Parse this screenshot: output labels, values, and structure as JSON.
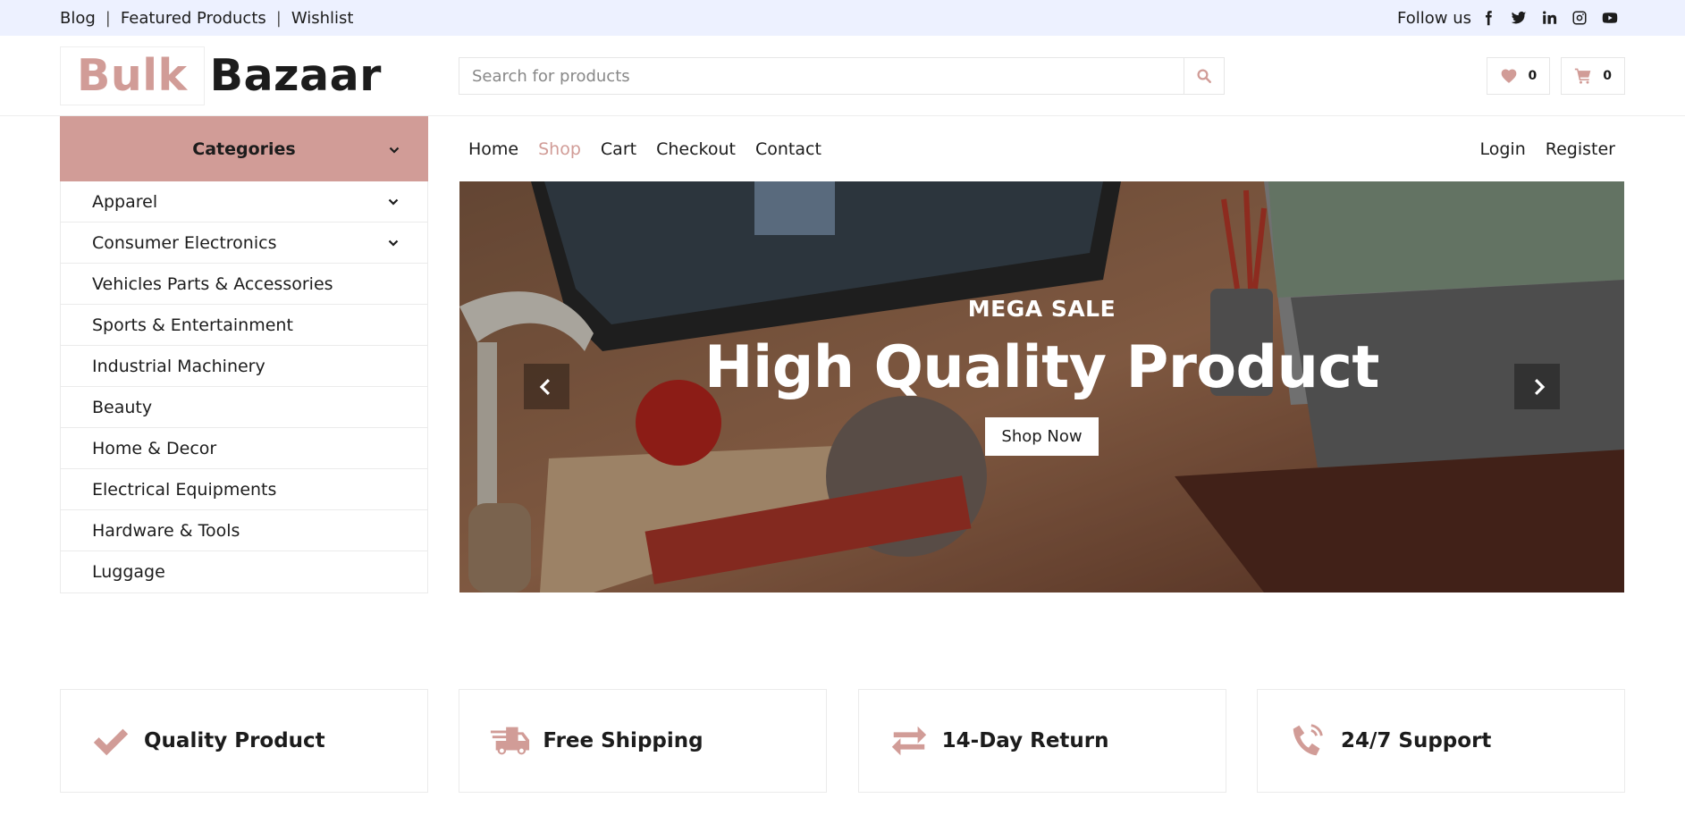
{
  "topbar": {
    "links": [
      "Blog",
      "Featured Products",
      "Wishlist"
    ],
    "follow_label": "Follow us",
    "social": [
      "facebook-icon",
      "twitter-icon",
      "linkedin-icon",
      "instagram-icon",
      "youtube-icon"
    ]
  },
  "brand": {
    "part1": "Bulk",
    "part2": "Bazaar",
    "accent": "#d19c97"
  },
  "search": {
    "placeholder": "Search for products"
  },
  "header_icons": {
    "wishlist_count": "0",
    "cart_count": "0"
  },
  "categories": {
    "title": "Categories",
    "items": [
      {
        "label": "Apparel",
        "has_submenu": true
      },
      {
        "label": "Consumer Electronics",
        "has_submenu": true
      },
      {
        "label": "Vehicles Parts & Accessories",
        "has_submenu": false
      },
      {
        "label": "Sports & Entertainment",
        "has_submenu": false
      },
      {
        "label": "Industrial Machinery",
        "has_submenu": false
      },
      {
        "label": "Beauty",
        "has_submenu": false
      },
      {
        "label": "Home & Decor",
        "has_submenu": false
      },
      {
        "label": "Electrical Equipments",
        "has_submenu": false
      },
      {
        "label": "Hardware & Tools",
        "has_submenu": false
      },
      {
        "label": "Luggage",
        "has_submenu": false
      }
    ]
  },
  "nav": {
    "left": [
      "Home",
      "Shop",
      "Cart",
      "Checkout",
      "Contact"
    ],
    "active": "Shop",
    "right": [
      "Login",
      "Register"
    ]
  },
  "banner": {
    "subtitle": "MEGA SALE",
    "title": "High Quality Product",
    "button": "Shop Now"
  },
  "features": [
    {
      "icon": "check-icon",
      "label": "Quality Product"
    },
    {
      "icon": "shipping-truck-icon",
      "label": "Free Shipping"
    },
    {
      "icon": "exchange-arrows-icon",
      "label": "14-Day Return"
    },
    {
      "icon": "phone-volume-icon",
      "label": "24/7 Support"
    }
  ]
}
